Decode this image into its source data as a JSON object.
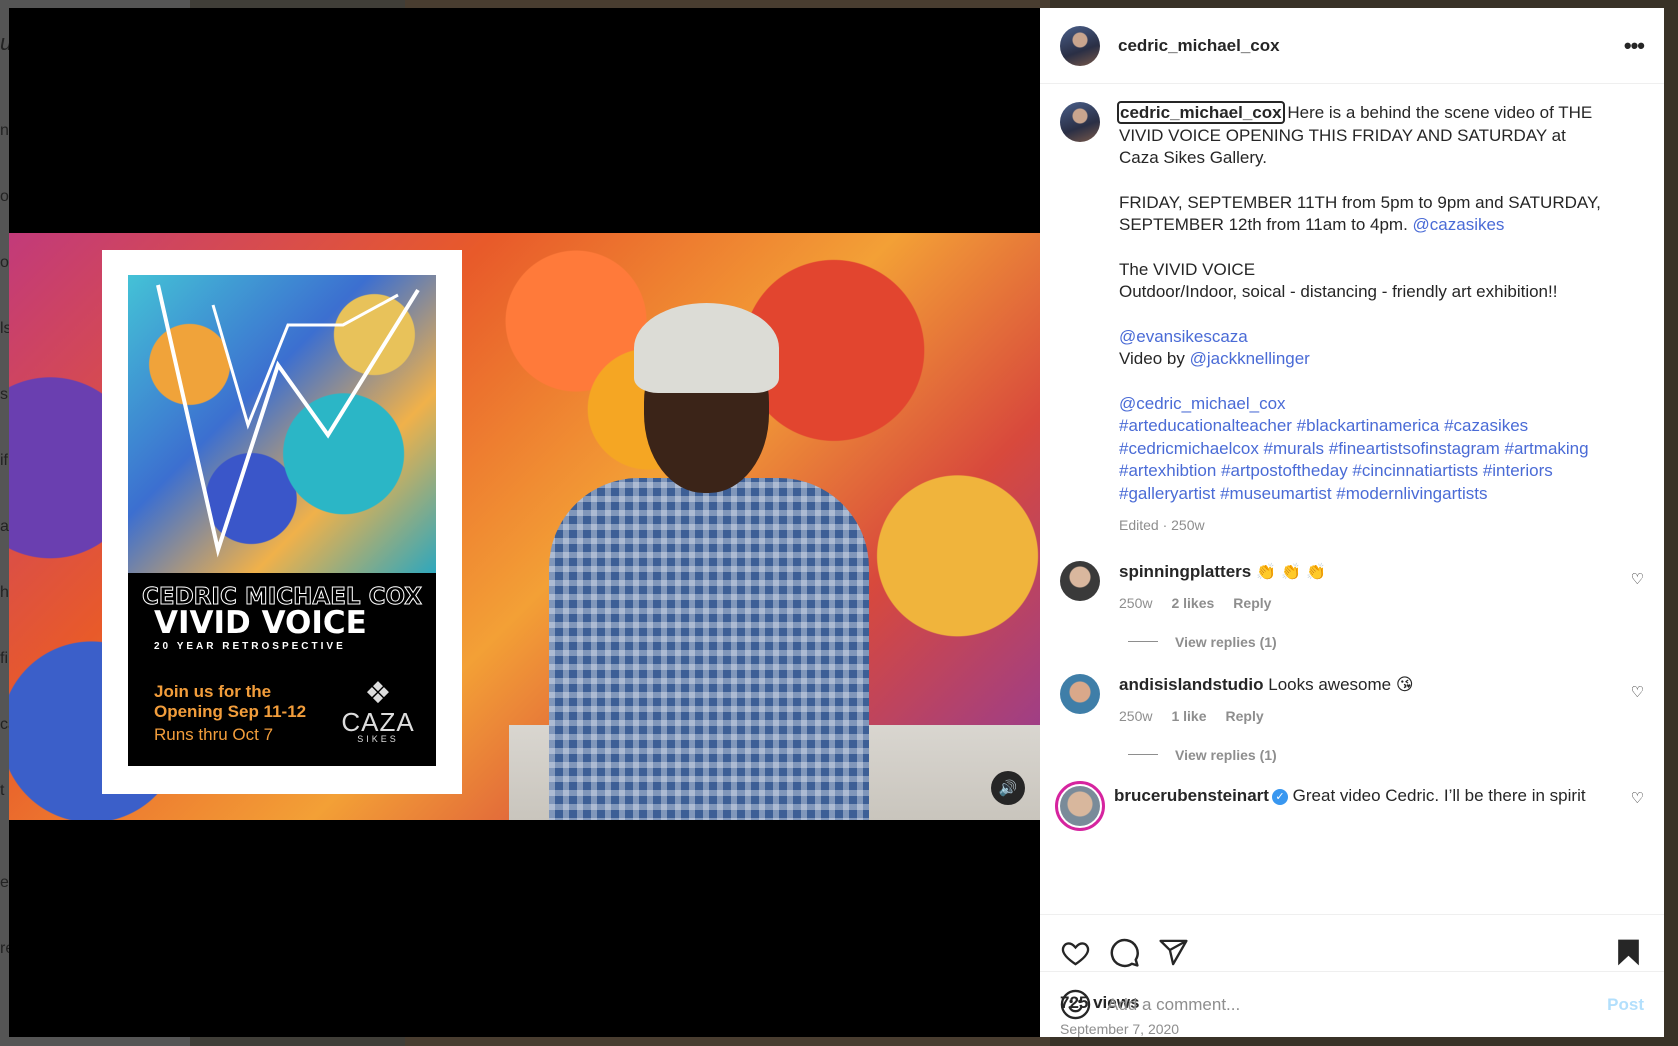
{
  "post": {
    "username": "cedric_michael_cox",
    "more_label": "•••"
  },
  "video": {
    "poster": {
      "artist": "CEDRIC MICHAEL COX",
      "title": "VIVID VOICE",
      "subtitle": "20 YEAR RETROSPECTIVE",
      "join_line1": "Join us for the",
      "join_line2": "Opening Sep 11-12",
      "runs": "Runs thru Oct 7",
      "brand": "CAZA",
      "brand_sub": "SIKES"
    },
    "mute_icon": "speaker-icon"
  },
  "caption": {
    "username": "cedric_michael_cox",
    "text1": " Here is a behind the scene video of THE VIVID VOICE OPENING THIS FRIDAY AND SATURDAY at Caza Sikes Gallery.",
    "text2": "FRIDAY, SEPTEMBER 11TH from 5pm to 9pm and SATURDAY, SEPTEMBER 12th from 11am to 4pm.",
    "mention1": "@cazasikes",
    "text3a": "The VIVID VOICE",
    "text3b": "Outdoor/Indoor, soical - distancing - friendly art exhibition!!",
    "mention2": "@evansikescaza",
    "video_by": "Video by",
    "mention3": "@jackknellinger",
    "mention4": "@cedric_michael_cox",
    "hashtags_line1": "#arteducationalteacher #blackartinamerica #cazasikes",
    "hashtags_line2": "#cedricmichaelcox #murals #fineartistsofinstagram #artmaking",
    "hashtags_line3": "#artexhibtion #artpostoftheday #cincinnatiartists #interiors",
    "hashtags_line4": "#galleryartist #museumartist #modernlivingartists",
    "meta": "Edited · 250w"
  },
  "comments": [
    {
      "username": "spinningplatters",
      "text": "👏 👏 👏",
      "time": "250w",
      "likes": "2 likes",
      "reply": "Reply",
      "view_replies": "View replies (1)"
    },
    {
      "username": "andisislandstudio",
      "text": "Looks awesome 😘",
      "time": "250w",
      "likes": "1 like",
      "reply": "Reply",
      "view_replies": "View replies (1)"
    },
    {
      "username": "brucerubensteinart",
      "text": "Great video Cedric. I’ll be there in spirit"
    }
  ],
  "stats": {
    "views": "725 views",
    "date": "September 7, 2020"
  },
  "composer": {
    "placeholder": "Add a comment...",
    "post_label": "Post"
  },
  "backdrop_letters": [
    "u",
    "n",
    "o",
    "o",
    "ls",
    "s",
    "if",
    "a",
    "h",
    "fi",
    "ca",
    "t",
    "ea",
    "re"
  ]
}
